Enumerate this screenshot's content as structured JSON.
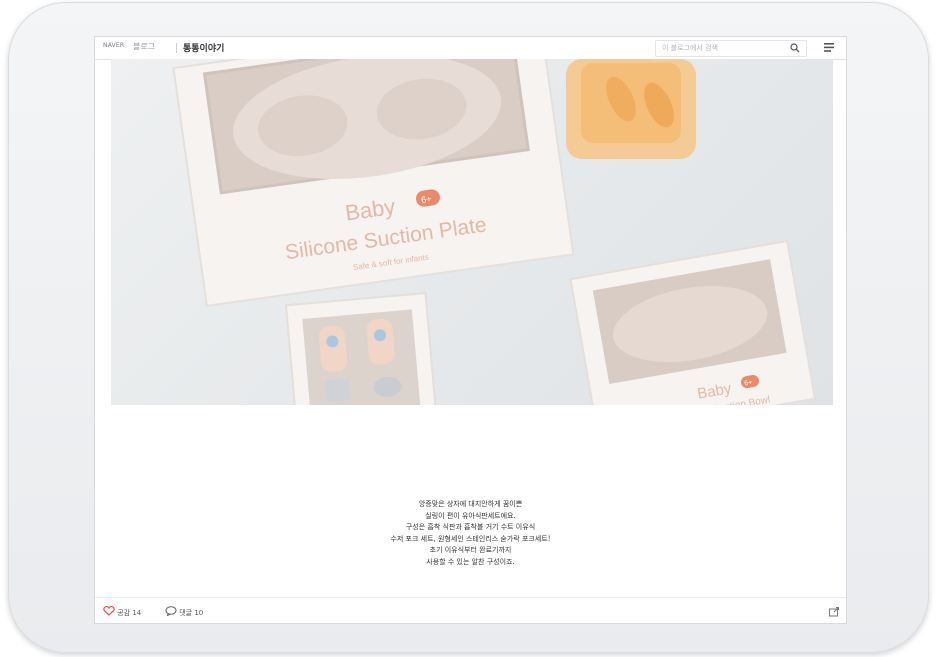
{
  "header": {
    "brand": "NAVER",
    "brand_sub": "블로그",
    "blog_title": "통통이야기",
    "search_placeholder": "이 블로그에서 검색"
  },
  "photo": {
    "box1_title": "Baby",
    "box1_badge": "6+",
    "box1_subtitle": "Silicone Suction Plate",
    "box1_caption": "Safe & soft for infants",
    "box2_title": "Baby",
    "box2_badge": "6+",
    "box2_subtitle": "Silicone Suction Bowl"
  },
  "post_text": [
    "앙증맞은 상자에 대지안하게 꿈이쁜",
    "실링이 편이 유아식판세트에요.",
    "구성은 흡착 식판과 흡착볼 거기 수트 이유식",
    "수저 포크 세트, 원형세인 스테인리스 숟가락 포크세트!",
    "초기 이유식부터 완료기까지",
    "사용할 수 있는 알찬 구성이죠."
  ],
  "footer": {
    "like_label": "공감 14",
    "comment_label": "댓글 10"
  },
  "colors": {
    "accent_red": "#e8505b",
    "box_text": "#e1b6a4"
  }
}
